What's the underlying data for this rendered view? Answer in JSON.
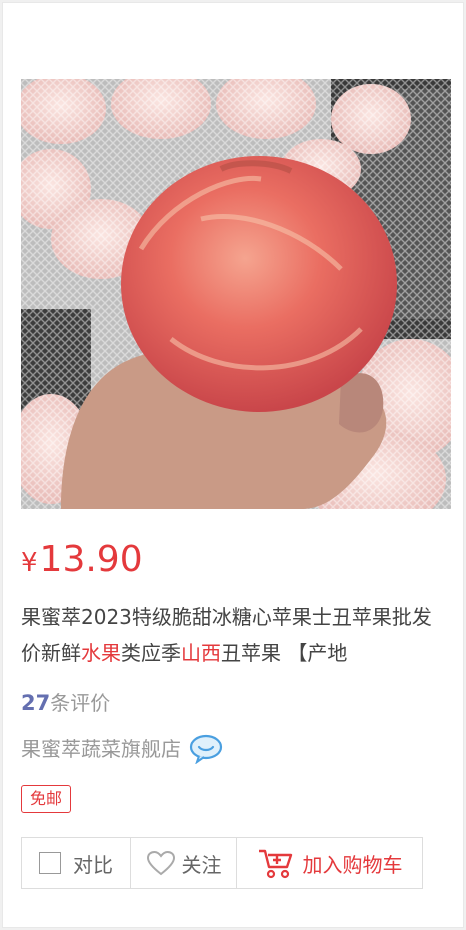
{
  "product": {
    "price_symbol": "¥",
    "price_value": "13.90",
    "title_part1": "果蜜萃2023特级脆甜冰糖心苹果士丑苹果批发价新鲜",
    "title_hl1": "水果",
    "title_part2": "类应季",
    "title_hl2": "山西",
    "title_part3": "丑苹果 【产地",
    "comment_count": "27",
    "comment_suffix": "条评价",
    "shop_name": "果蜜萃蔬菜旗舰店",
    "free_shipping_badge": "免邮"
  },
  "actions": {
    "compare_label": "对比",
    "follow_label": "关注",
    "cart_label": "加入购物车"
  },
  "icons": {
    "chat": "chat-bubble-icon",
    "heart": "heart-icon",
    "cart": "cart-icon"
  },
  "colors": {
    "accent": "#e4393c",
    "comment_count": "#646fb0",
    "muted_text": "#999999"
  }
}
